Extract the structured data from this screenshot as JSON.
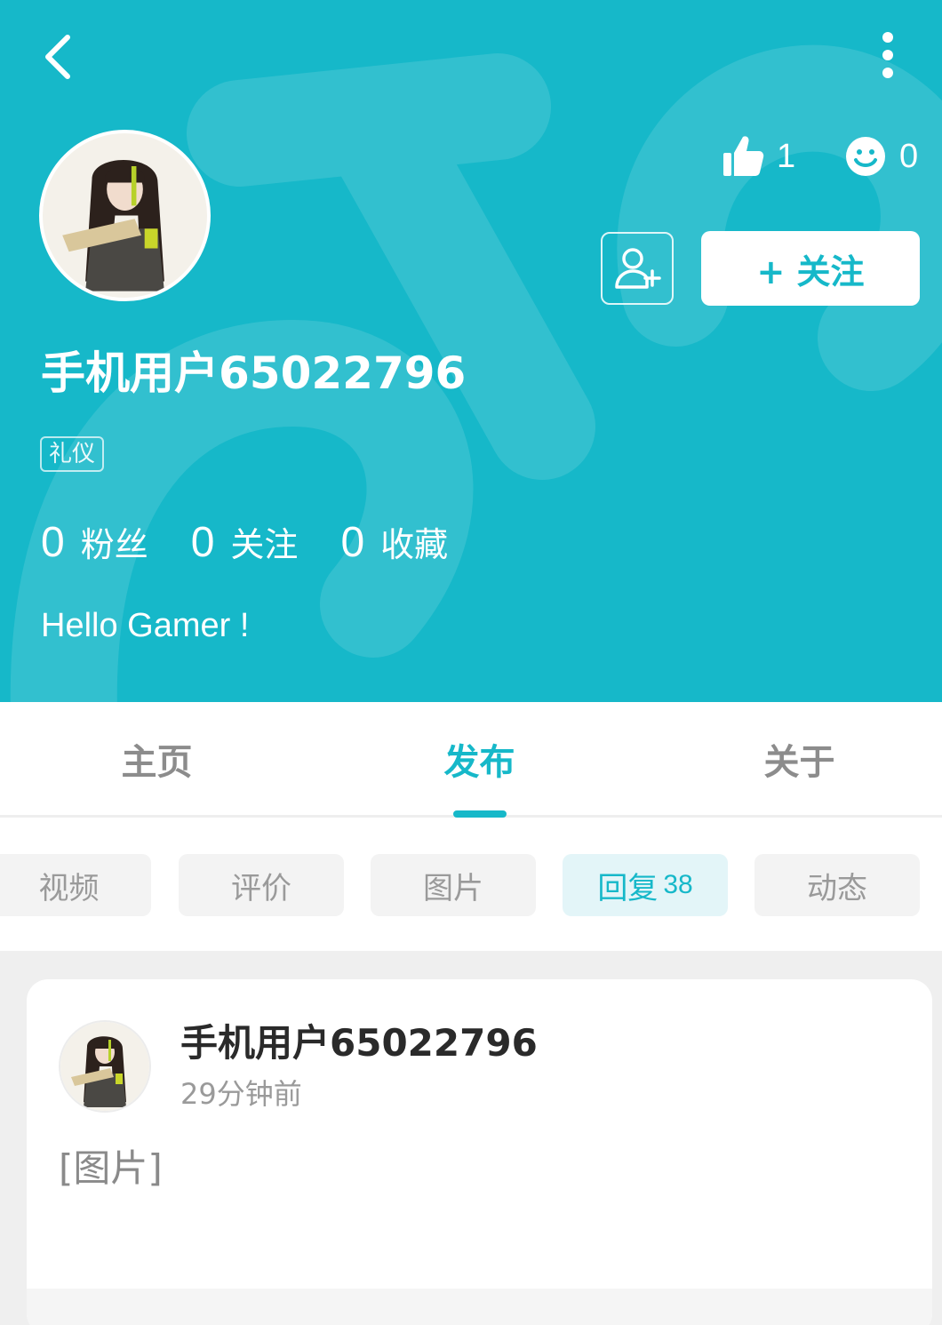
{
  "theme": {
    "accent": "#16b8c9",
    "background": "#ffffff",
    "feed_background": "#efefef"
  },
  "header": {
    "back_icon": "chevron-left-icon",
    "more_icon": "more-vertical-icon",
    "likes": {
      "icon": "thumbs-up-icon",
      "count": "1"
    },
    "reactions": {
      "icon": "smile-icon",
      "count": "0"
    },
    "add_friend_icon": "add-user-icon",
    "follow_label": "+ 关注",
    "username": "手机用户65022796",
    "badge": "礼仪",
    "counts": [
      {
        "value": "0",
        "label": "粉丝"
      },
      {
        "value": "0",
        "label": "关注"
      },
      {
        "value": "0",
        "label": "收藏"
      }
    ],
    "bio": "Hello Gamer !"
  },
  "tabs": [
    {
      "label": "主页",
      "active": false
    },
    {
      "label": "发布",
      "active": true
    },
    {
      "label": "关于",
      "active": false
    }
  ],
  "chips": [
    {
      "label": "视频",
      "count": "",
      "active": false
    },
    {
      "label": "评价",
      "count": "",
      "active": false
    },
    {
      "label": "图片",
      "count": "",
      "active": false
    },
    {
      "label": "回复",
      "count": "38",
      "active": true
    },
    {
      "label": "动态",
      "count": "",
      "active": false
    }
  ],
  "feed": [
    {
      "author": "手机用户65022796",
      "time": "29分钟前",
      "content": "[图片]"
    }
  ]
}
